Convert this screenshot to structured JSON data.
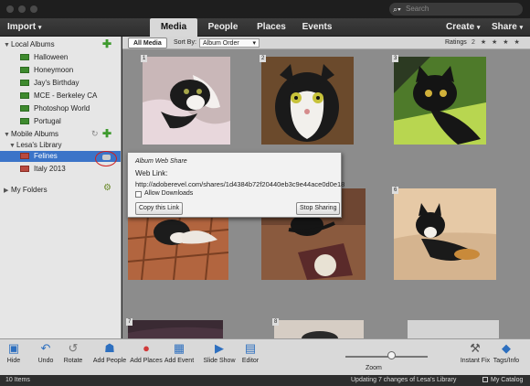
{
  "search": {
    "placeholder": "Search"
  },
  "menubar": {
    "import_label": "Import",
    "tabs": [
      {
        "label": "Media"
      },
      {
        "label": "People"
      },
      {
        "label": "Places"
      },
      {
        "label": "Events"
      }
    ],
    "create_label": "Create",
    "share_label": "Share"
  },
  "sidebar": {
    "local_albums_title": "Local Albums",
    "local_albums": [
      "Halloween",
      "Honeymoon",
      "Jay's Birthday",
      "MCE - Berkeley CA",
      "Photoshop World",
      "Portugal"
    ],
    "mobile_albums_title": "Mobile Albums",
    "library_name": "Lesa's Library",
    "mobile_albums": [
      "Felines",
      "Italy 2013"
    ],
    "my_folders_title": "My Folders"
  },
  "content_toolbar": {
    "all_media_label": "All Media",
    "sort_by_label": "Sort By:",
    "sort_value": "Album Order",
    "ratings_label": "Ratings",
    "stars": "2 ★ ★ ★ ★ ★"
  },
  "grid": {
    "numbers": [
      "1",
      "2",
      "3",
      "4",
      "5",
      "6",
      "7",
      "8"
    ]
  },
  "popup": {
    "title": "Album Web Share",
    "web_link_label": "Web Link:",
    "url": "http://adoberevel.com/shares/1d4384b72f20440eb3c9e44ace0d0e18",
    "allow_downloads_label": "Allow Downloads",
    "copy_link_label": "Copy this Link",
    "stop_sharing_label": "Stop Sharing"
  },
  "bottombar": {
    "hide": "Hide",
    "undo": "Undo",
    "rotate": "Rotate",
    "add_people": "Add People",
    "add_places": "Add Places",
    "add_event": "Add Event",
    "slide_show": "Slide Show",
    "editor": "Editor",
    "zoom": "Zoom",
    "instant_fix": "Instant Fix",
    "tags_info": "Tags/Info"
  },
  "status": {
    "items": "10 Items",
    "sync": "Updating 7 changes of Lesa's Library",
    "catalog": "My Catalog"
  },
  "colors": {
    "selection": "#3b74c8",
    "album_green": "#3e8a2e",
    "album_red": "#b9493f",
    "annotation_circle": "#d02020"
  }
}
